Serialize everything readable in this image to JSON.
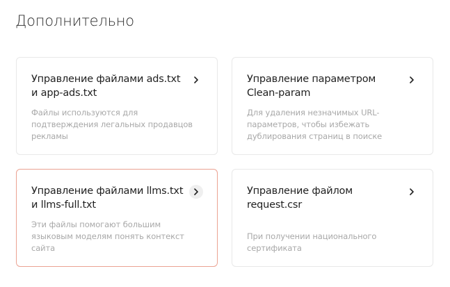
{
  "section": {
    "title": "Дополнительно"
  },
  "cards": [
    {
      "title_line1": "Управление файлами ads.txt",
      "title_line2": "и app-ads.txt",
      "desc_line1": "Файлы используются для",
      "desc_line2": "подтверждения легальных продавцов",
      "desc_line3": "рекламы"
    },
    {
      "title_line1": "Управление параметром",
      "title_line2": "Clean-param",
      "desc_line1": "Для удаления незначимых URL-",
      "desc_line2": "параметров, чтобы избежать",
      "desc_line3": "дублирования страниц в поиске"
    },
    {
      "title_line1": "Управление файлами llms.txt",
      "title_line2": "и llms-full.txt",
      "desc_line1": "Эти файлы помогают большим",
      "desc_line2": "языковым моделям понять контекст",
      "desc_line3": "сайта"
    },
    {
      "title_line1": "Управление файлом",
      "title_line2": "request.csr",
      "desc_line1": "При получении национального",
      "desc_line2": "сертификата"
    }
  ],
  "icons": {
    "card_arrow": "chevron-right-icon"
  },
  "colors": {
    "active_border": "#eba292",
    "card_border": "#e8e8e8",
    "title_text": "#1f1f1f",
    "desc_text": "#a8a8a8"
  }
}
